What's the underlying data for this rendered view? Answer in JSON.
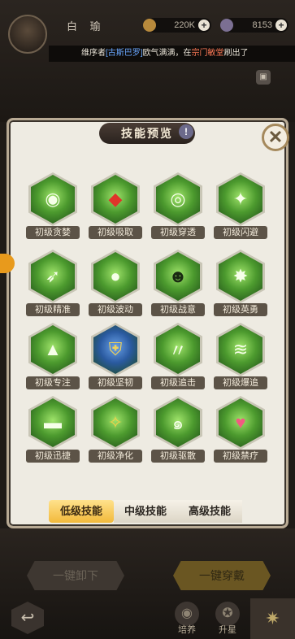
{
  "player": {
    "name": "白 瑜"
  },
  "resources": {
    "coins": "220K",
    "gems": "8153"
  },
  "ticker": {
    "prefix": "维序者",
    "name": "[古斯巴罗]",
    "middle": "欧气满满，在",
    "place": "宗门敏堂",
    "suffix": "刷出了"
  },
  "panel": {
    "title": "技能预览"
  },
  "skills": [
    {
      "label": "初级贪婪",
      "icon": "flame-ring-icon",
      "glyph": "◉"
    },
    {
      "label": "初级吸取",
      "icon": "blood-drop-icon",
      "glyph": "◆"
    },
    {
      "label": "初级穿透",
      "icon": "target-icon",
      "glyph": "◎"
    },
    {
      "label": "初级闪避",
      "icon": "dodge-figure-icon",
      "glyph": "✦"
    },
    {
      "label": "初级精准",
      "icon": "arrow-icon",
      "glyph": "➶"
    },
    {
      "label": "初级波动",
      "icon": "orb-wave-icon",
      "glyph": "●"
    },
    {
      "label": "初级战意",
      "icon": "spirit-icon",
      "glyph": "☻"
    },
    {
      "label": "初级英勇",
      "icon": "burst-icon",
      "glyph": "✸"
    },
    {
      "label": "初级专注",
      "icon": "crystal-icon",
      "glyph": "▲"
    },
    {
      "label": "初级坚韧",
      "icon": "shield-icon",
      "glyph": "⛨"
    },
    {
      "label": "初级追击",
      "icon": "slash-icon",
      "glyph": "〃"
    },
    {
      "label": "初级爆追",
      "icon": "claw-icon",
      "glyph": "≋"
    },
    {
      "label": "初级迅捷",
      "icon": "boot-icon",
      "glyph": "▬"
    },
    {
      "label": "初级净化",
      "icon": "aura-icon",
      "glyph": "✧"
    },
    {
      "label": "初级驱散",
      "icon": "swirl-icon",
      "glyph": "๑"
    },
    {
      "label": "初级禁疗",
      "icon": "heart-icon",
      "glyph": "♥"
    }
  ],
  "tabs": {
    "low": "低级技能",
    "mid": "中级技能",
    "high": "高级技能"
  },
  "actions": {
    "unequip": "一键卸下",
    "equip": "一键穿戴"
  },
  "nav": {
    "train": "培养",
    "upgrade": "升星"
  }
}
